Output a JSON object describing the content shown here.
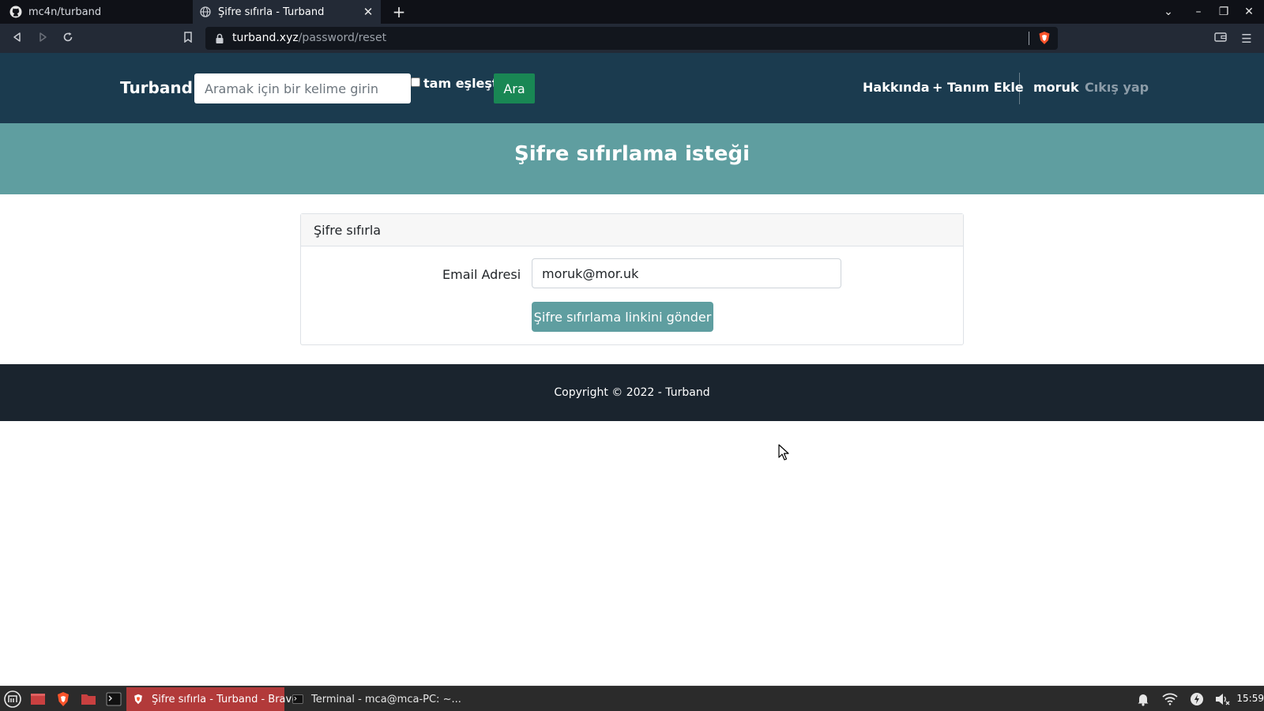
{
  "browser": {
    "tabs": [
      {
        "label": "mc4n/turband",
        "active": false
      },
      {
        "label": "Şifre sıfırla - Turband",
        "active": true
      }
    ],
    "url_host": "turband.xyz",
    "url_path": "/password/reset"
  },
  "header": {
    "brand": "Turband",
    "search_placeholder": "Aramak için bir kelime girin",
    "exact_match_label": "tam eşleştir",
    "search_button": "Ara",
    "nav": {
      "about": "Hakkında",
      "add_definition": "+ Tanım Ekle",
      "username": "moruk",
      "logout": "Cıkış yap"
    }
  },
  "hero": {
    "title": "Şifre sıfırlama isteği"
  },
  "card": {
    "header": "Şifre sıfırla",
    "email_label": "Email Adresi",
    "email_value": "moruk@mor.uk",
    "submit_button": "Şifre sıfırlama linkini gönder"
  },
  "footer": {
    "copyright": "Copyright © 2022 - Turband"
  },
  "taskbar": {
    "tasks": [
      {
        "label": "Şifre sıfırla - Turband - Brave",
        "active": true
      },
      {
        "label": "Terminal - mca@mca-PC: ~...",
        "active": false
      }
    ],
    "clock": "15:59"
  },
  "colors": {
    "header_bg": "#1b3b4f",
    "hero_bg": "#5f9ea0",
    "search_button": "#198754",
    "footer_bg": "#1a242e"
  }
}
